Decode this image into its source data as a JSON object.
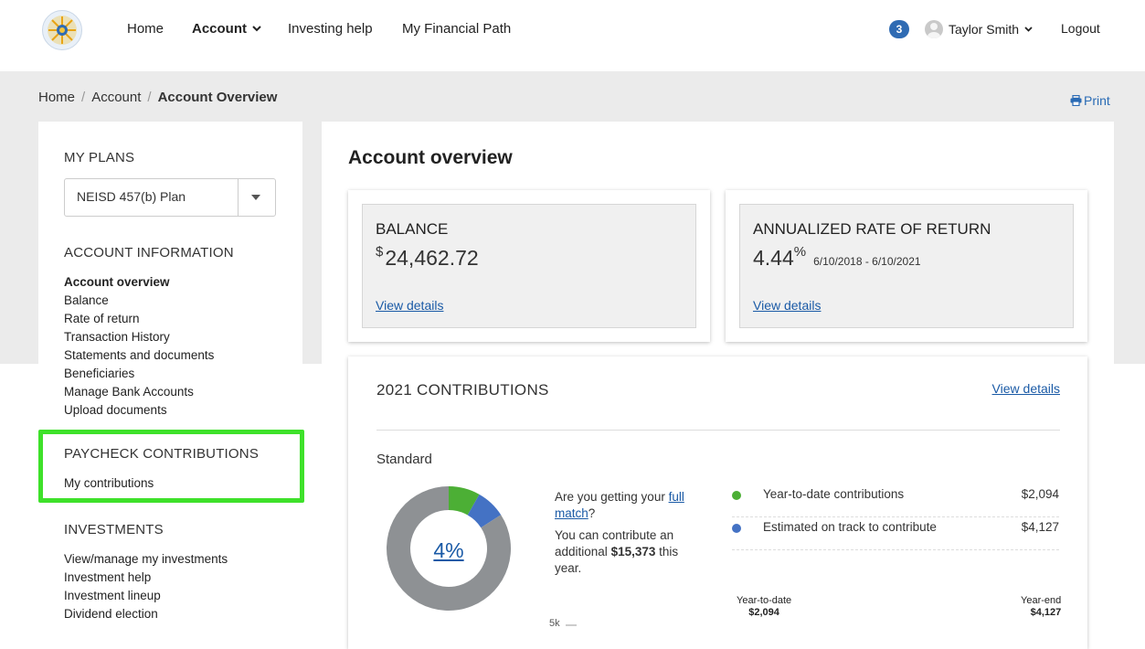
{
  "nav": {
    "home": "Home",
    "account": "Account",
    "investing_help": "Investing help",
    "financial_path": "My Financial Path",
    "notification_count": "3",
    "user_name": "Taylor Smith",
    "logout": "Logout"
  },
  "breadcrumb": {
    "home": "Home",
    "account": "Account",
    "current": "Account Overview",
    "print": "Print"
  },
  "sidebar": {
    "my_plans_heading": "MY PLANS",
    "plan_selected": "NEISD 457(b) Plan",
    "account_info_heading": "ACCOUNT INFORMATION",
    "account_items": [
      "Account overview",
      "Balance",
      "Rate of return",
      "Transaction History",
      "Statements and documents",
      "Beneficiaries",
      "Manage Bank Accounts",
      "Upload documents"
    ],
    "paycheck_heading": "PAYCHECK CONTRIBUTIONS",
    "paycheck_items": [
      "My contributions"
    ],
    "investments_heading": "INVESTMENTS",
    "investment_items": [
      "View/manage my investments",
      "Investment help",
      "Investment lineup",
      "Dividend election"
    ]
  },
  "main": {
    "title": "Account overview",
    "balance": {
      "label": "BALANCE",
      "currency": "$",
      "value": "24,462.72",
      "link": "View details"
    },
    "rate": {
      "label": "ANNUALIZED RATE OF RETURN",
      "value": "4.44",
      "unit": "%",
      "range": "6/10/2018 - 6/10/2021",
      "link": "View details"
    },
    "contributions": {
      "title": "2021 CONTRIBUTIONS",
      "link": "View details",
      "standard_label": "Standard",
      "rate_pct": "4%",
      "match_q_before": "Are you getting your ",
      "match_q_link": "full match",
      "match_q_after": "?",
      "additional_before": "You can contribute an additional ",
      "additional_amount": "$15,373",
      "additional_after": " this year.",
      "legend": [
        {
          "label": "Year-to-date contributions",
          "value": "$2,094",
          "color": "#4caf35"
        },
        {
          "label": "Estimated on track to contribute",
          "value": "$4,127",
          "color": "#4472c4"
        }
      ],
      "bar_labels": {
        "ytd_label": "Year-to-date",
        "ytd_value": "$2,094",
        "yearend_label": "Year-end",
        "yearend_value": "$4,127",
        "axis_5k": "5k"
      },
      "donut": {
        "total_color": "#8e9194",
        "segments": [
          {
            "name": "Year-to-date contributions",
            "fraction": 0.082,
            "color": "#4caf35"
          },
          {
            "name": "Estimated on track to contribute",
            "fraction": 0.077,
            "color": "#4472c4"
          }
        ]
      }
    }
  }
}
